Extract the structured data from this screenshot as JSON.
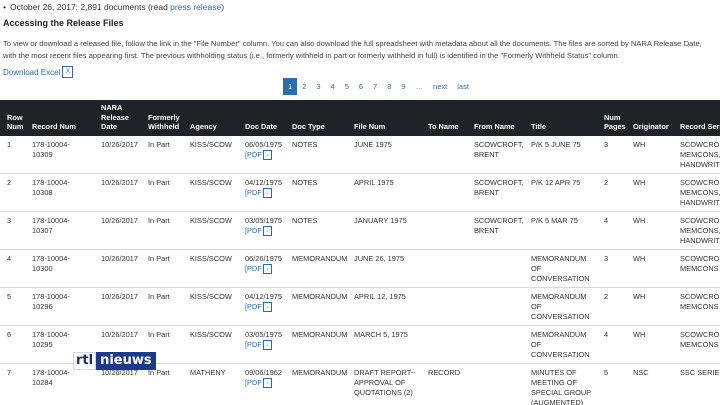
{
  "release_line": {
    "date_text": "October 26, 2017: 2,891 documents (read ",
    "link": "press release",
    "close": ")"
  },
  "heading": "Accessing the Release Files",
  "intro": "To view or download a released file, follow the link in the \"File Number\" column. You can also download the full spreadsheet with metadata about all the documents. The files are sorted by NARA Release Date, with the most recent files appearing first. The previous withholding status (i.e., formerly withheld in part or formerly withheld in full) is identified in the \"Formerly Withheld Status\" column.",
  "download": {
    "label": "Download Excel",
    "icon": "excel-file-icon"
  },
  "pagination": {
    "pages": [
      "1",
      "2",
      "3",
      "4",
      "5",
      "6",
      "7",
      "8",
      "9"
    ],
    "current": "1",
    "ellipsis": "…",
    "next": "next",
    "last": "last"
  },
  "table": {
    "headers": [
      "Row Num",
      "Record Num",
      "NARA Release Date",
      "Formerly Withheld",
      "Agency",
      "Doc Date",
      "Doc Type",
      "File Num",
      "To Name",
      "From Name",
      "Title",
      "Num Pages",
      "Originator",
      "Record Series"
    ],
    "pdf_label": "[PDF",
    "rows": [
      {
        "row": "1",
        "record": "178-10004-10309",
        "release": "10/26/2017",
        "withheld": "In Part",
        "agency": "KISS/SCOW",
        "doc_date": "06/05/1975",
        "doc_type": "NOTES",
        "file_num": "JUNE 1975",
        "to": "",
        "from": "SCOWCROFT, BRENT",
        "title": "P/K 5 JUNE 75",
        "pages": "3",
        "originator": "WH",
        "series": "SCOWCROFT MEMCONS, HANDWRITTEN"
      },
      {
        "row": "2",
        "record": "178-10004-10308",
        "release": "10/26/2017",
        "withheld": "In Part",
        "agency": "KISS/SCOW",
        "doc_date": "04/12/1975",
        "doc_type": "NOTES",
        "file_num": "APRIL 1975",
        "to": "",
        "from": "SCOWCROFT, BRENT",
        "title": "P/K 12 APR 75",
        "pages": "2",
        "originator": "WH",
        "series": "SCOWCROFT MEMCONS, HANDWRITTEN"
      },
      {
        "row": "3",
        "record": "178-10004-10307",
        "release": "10/26/2017",
        "withheld": "In Part",
        "agency": "KISS/SCOW",
        "doc_date": "03/05/1975",
        "doc_type": "NOTES",
        "file_num": "JANUARY 1975",
        "to": "",
        "from": "SCOWCROFT, BRENT",
        "title": "P/K 5 MAR 75",
        "pages": "4",
        "originator": "WH",
        "series": "SCOWCROFT MEMCONS, HANDWRITTEN"
      },
      {
        "row": "4",
        "record": "178-10004-10300",
        "release": "10/26/2017",
        "withheld": "In Part",
        "agency": "KISS/SCOW",
        "doc_date": "06/26/1975",
        "doc_type": "MEMORANDUM",
        "file_num": "JUNE 26, 1975",
        "to": "",
        "from": "",
        "title": "MEMORANDUM OF CONVERSATION",
        "pages": "3",
        "originator": "WH",
        "series": "SCOWCROFT MEMCONS"
      },
      {
        "row": "5",
        "record": "178-10004-10296",
        "release": "10/26/2017",
        "withheld": "In Part",
        "agency": "KISS/SCOW",
        "doc_date": "04/12/1975",
        "doc_type": "MEMORANDUM",
        "file_num": "APRIL 12, 1975",
        "to": "",
        "from": "",
        "title": "MEMORANDUM OF CONVERSATION",
        "pages": "2",
        "originator": "WH",
        "series": "SCOWCROFT MEMCONS"
      },
      {
        "row": "6",
        "record": "178-10004-10295",
        "release": "10/26/2017",
        "withheld": "In Part",
        "agency": "KISS/SCOW",
        "doc_date": "03/05/1975",
        "doc_type": "MEMORANDUM",
        "file_num": "MARCH 5, 1975",
        "to": "",
        "from": "",
        "title": "MEMORANDUM OF CONVERSATION",
        "pages": "4",
        "originator": "WH",
        "series": "SCOWCROFT MEMCONS"
      },
      {
        "row": "7",
        "record": "178-10004-10284",
        "release": "10/26/2017",
        "withheld": "In Part",
        "agency": "MATHENY",
        "doc_date": "09/06/1962",
        "doc_type": "MEMORANDUM",
        "file_num": "DRAFT REPORT--APPROVAL OF QUOTATIONS (2)",
        "to": "RECORD",
        "from": "",
        "title": "MINUTES OF MEETING OF SPECIAL GROUP (AUGMENTED) ON",
        "pages": "5",
        "originator": "NSC",
        "series": "SSC SERIES"
      }
    ]
  },
  "watermark": {
    "left": "rtl",
    "right": "nieuws"
  }
}
